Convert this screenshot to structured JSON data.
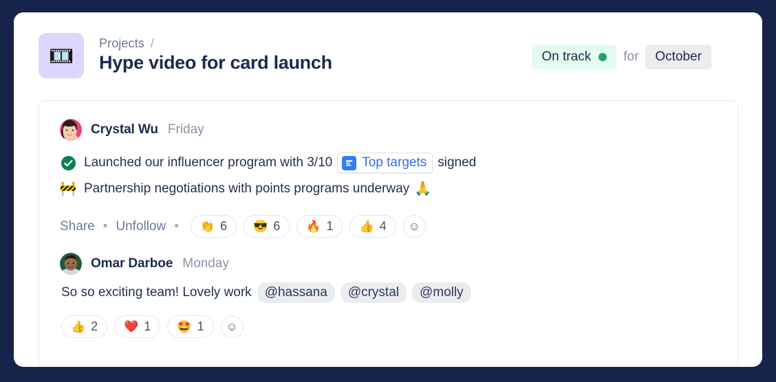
{
  "header": {
    "project_icon": "film-frames-icon",
    "project_icon_glyph": "🎞️",
    "breadcrumb_parent": "Projects",
    "breadcrumb_separator": "/",
    "title": "Hype video for card launch",
    "status_label": "On track",
    "status_color": "#22a06b",
    "status_bg": "#e3fcef",
    "for_label": "for",
    "period_label": "October"
  },
  "update": {
    "author": "Crystal Wu",
    "time": "Friday",
    "lines": [
      {
        "icon": "check-circle-icon",
        "text_before": "Launched our influencer program with 3/10",
        "chip_label": "Top targets",
        "chip_icon": "document-icon",
        "text_after": "signed",
        "trailing_emoji": ""
      },
      {
        "icon": "construction-icon",
        "icon_glyph": "🚧",
        "text_before": "Partnership negotiations with points programs underway",
        "trailing_emoji": "🙏"
      }
    ],
    "actions": {
      "share": "Share",
      "unfollow": "Unfollow",
      "separator": "•"
    },
    "reactions": [
      {
        "emoji": "👏",
        "name": "clap",
        "count": "6"
      },
      {
        "emoji": "😎",
        "name": "sunglasses",
        "count": "6"
      },
      {
        "emoji": "🔥",
        "name": "fire",
        "count": "1"
      },
      {
        "emoji": "👍",
        "name": "thumbs-up",
        "count": "4"
      }
    ],
    "add_reaction_glyph": "☺"
  },
  "comment": {
    "author": "Omar Darboe",
    "time": "Monday",
    "text": "So so exciting team! Lovely work",
    "mentions": [
      "@hassana",
      "@crystal",
      "@molly"
    ],
    "reactions": [
      {
        "emoji": "👍",
        "name": "thumbs-up",
        "count": "2"
      },
      {
        "emoji": "❤️",
        "name": "heart",
        "count": "1"
      },
      {
        "emoji": "🤩",
        "name": "star-struck",
        "count": "1"
      }
    ],
    "add_reaction_glyph": "☺"
  }
}
